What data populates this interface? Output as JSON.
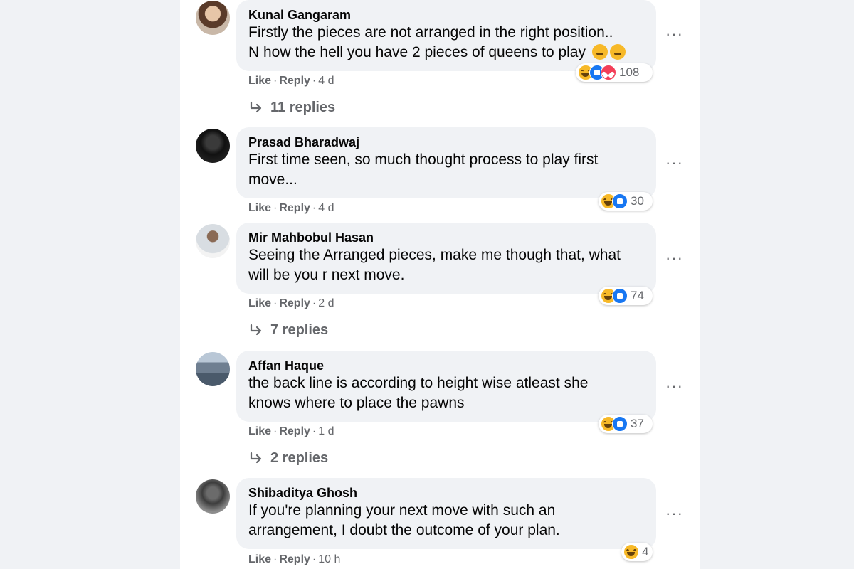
{
  "comments": [
    {
      "author": "Kunal Gangaram",
      "text": "Firstly the pieces are not arranged in the right position..\nN how the hell you have 2 pieces of queens to play",
      "inline_emojis": [
        "thinking-face-emoji",
        "thinking-face-emoji"
      ],
      "reactions": [
        "haha",
        "like",
        "love"
      ],
      "reaction_count": "108",
      "actions": {
        "like": "Like",
        "reply": "Reply",
        "time": "4 d"
      },
      "replies_label": "11 replies"
    },
    {
      "author": "Prasad Bharadwaj",
      "text": "First time seen, so much thought process to play first\nmove...",
      "reactions": [
        "haha",
        "like"
      ],
      "reaction_count": "30",
      "actions": {
        "like": "Like",
        "reply": "Reply",
        "time": "4 d"
      }
    },
    {
      "author": "Mir Mahbobul Hasan",
      "text": "Seeing the Arranged pieces, make me though that, what\nwill be you r next move.",
      "reactions": [
        "haha",
        "like"
      ],
      "reaction_count": "74",
      "actions": {
        "like": "Like",
        "reply": "Reply",
        "time": "2 d"
      },
      "replies_label": "7 replies"
    },
    {
      "author": "Affan Haque",
      "text": "the back line is according to height wise atleast she\nknows where to place the pawns",
      "reactions": [
        "haha",
        "like"
      ],
      "reaction_count": "37",
      "actions": {
        "like": "Like",
        "reply": "Reply",
        "time": "1 d"
      },
      "replies_label": "2 replies"
    },
    {
      "author": "Shibaditya Ghosh",
      "text": "If you're planning your next move with such an\narrangement, I doubt the outcome of your plan.",
      "reactions": [
        "haha"
      ],
      "reaction_count": "4",
      "actions": {
        "like": "Like",
        "reply": "Reply",
        "time": "10 h"
      }
    }
  ],
  "more_icon": "···",
  "colors": {
    "page_bg": "#f0f2f5",
    "bubble_bg": "#f0f2f5",
    "secondary_text": "#65676b",
    "like_blue": "#1877f2",
    "haha_yellow": "#f7b928",
    "love_red": "#f33e58"
  }
}
